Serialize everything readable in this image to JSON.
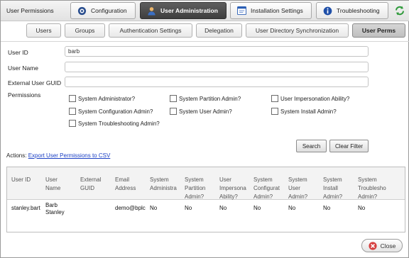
{
  "window": {
    "title": "User Permissions"
  },
  "main_tabs": [
    {
      "label": "Configuration",
      "icon": "gear-icon",
      "active": false
    },
    {
      "label": "User Administration",
      "icon": "user-icon",
      "active": true
    },
    {
      "label": "Installation Settings",
      "icon": "window-icon",
      "active": false
    },
    {
      "label": "Troubleshooting",
      "icon": "info-icon",
      "active": false
    }
  ],
  "refresh_icon": "refresh-icon",
  "sub_tabs": [
    {
      "label": "Users",
      "active": false
    },
    {
      "label": "Groups",
      "active": false
    },
    {
      "label": "Authentication Settings",
      "active": false
    },
    {
      "label": "Delegation",
      "active": false
    },
    {
      "label": "User Directory Synchronization",
      "active": false
    },
    {
      "label": "User Perms",
      "active": true
    }
  ],
  "form": {
    "user_id": {
      "label": "User ID",
      "value": "barb"
    },
    "user_name": {
      "label": "User Name",
      "value": ""
    },
    "external_guid": {
      "label": "External User GUID",
      "value": ""
    },
    "permissions_label": "Permissions",
    "permissions": [
      {
        "label": "System Administrator?",
        "checked": false
      },
      {
        "label": "System Partition Admin?",
        "checked": false
      },
      {
        "label": "User Impersonation Ability?",
        "checked": false
      },
      {
        "label": "System Configuration Admin?",
        "checked": false
      },
      {
        "label": "System User Admin?",
        "checked": false
      },
      {
        "label": "System Install Admin?",
        "checked": false
      },
      {
        "label": "System Troubleshooting Admin?",
        "checked": false
      }
    ],
    "search_label": "Search",
    "clear_filter_label": "Clear Filter"
  },
  "actions": {
    "prefix": "Actions:",
    "export_link": "Export User Permissions to CSV"
  },
  "grid": {
    "columns": [
      "User ID",
      "User\nName",
      "External\nGUID",
      "Email\nAddress",
      "System\nAdministra",
      "System\nPartition\nAdmin?",
      "User\nImpersona\nAbility?",
      "System\nConfigurat\nAdmin?",
      "System\nUser\nAdmin?",
      "System\nInstall\nAdmin?",
      "System\nTroublesho\nAdmin?"
    ],
    "rows": [
      [
        "stanley.bart",
        "Barb\nStanley",
        "",
        "demo@bplc",
        "No",
        "No",
        "No",
        "No",
        "No",
        "No",
        "No"
      ]
    ]
  },
  "close_label": "Close"
}
